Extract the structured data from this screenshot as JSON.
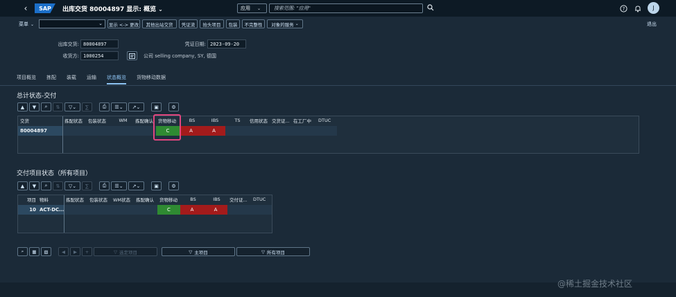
{
  "shell": {
    "title": "出库交货 80004897 显示: 概览",
    "scope": "应用",
    "search_placeholder": "搜索范围: \"应用\"",
    "avatar": "J"
  },
  "toolbar": {
    "menu": "菜单",
    "buttons": [
      "显示 <-> 更改",
      "其他出站交货",
      "凭证流",
      "抬头项目",
      "包装",
      "不完整性",
      "对象的服务"
    ],
    "exit": "退出"
  },
  "header": {
    "delivery_label": "出库交货:",
    "delivery_value": "80004897",
    "shipto_label": "收货方:",
    "shipto_value": "1000254",
    "shipto_desc": "公司 selling company, SY, 德国",
    "docdate_label": "凭证日期:",
    "docdate_value": "2023-09-20"
  },
  "tabs": [
    "项目概览",
    "拣配",
    "装载",
    "运输",
    "状态概览",
    "货物移动数据"
  ],
  "active_tab": 4,
  "section1": {
    "title": "总计状态-交付",
    "headers": [
      "交货",
      "拣配状态",
      "包装状态",
      "WM",
      "拣配确认",
      "货物移动",
      "BS",
      "IBS",
      "TS",
      "信用状态",
      "交货证...",
      "在工厂中",
      "DTUC"
    ],
    "row": [
      "80004897",
      "",
      "",
      "",
      "",
      "C",
      "A",
      "A",
      "",
      "",
      "",
      "",
      ""
    ]
  },
  "section2": {
    "title": "交付项目状态（所有项目）",
    "headers": [
      "项目",
      "物料",
      "拣配状态",
      "包装状态",
      "WM状态",
      "拣配确认",
      "货物移动",
      "BS",
      "IBS",
      "交付证...",
      "DTUC"
    ],
    "row": [
      "10",
      "ACT-DC...",
      "",
      "",
      "",
      "",
      "C",
      "A",
      "A",
      "",
      ""
    ]
  },
  "bottom_bar": {
    "prev_item": "选定项目",
    "main_items": "主项目",
    "all_items": "所有项目"
  },
  "watermark": "@稀土掘金技术社区",
  "colors": {
    "status_green": "#2f8a32",
    "status_red": "#a31b1b",
    "highlight": "#e0467e"
  }
}
